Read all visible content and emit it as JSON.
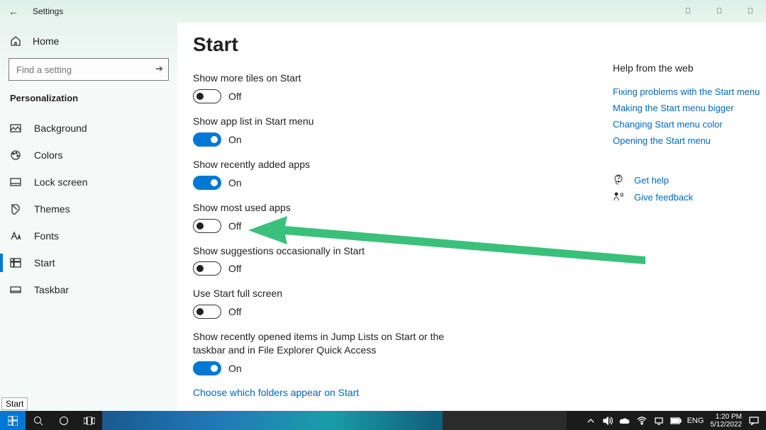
{
  "titlebar": {
    "title": "Settings"
  },
  "sidebar": {
    "home": "Home",
    "search_placeholder": "Find a setting",
    "category": "Personalization",
    "items": [
      {
        "id": "background",
        "label": "Background"
      },
      {
        "id": "colors",
        "label": "Colors"
      },
      {
        "id": "lockscreen",
        "label": "Lock screen"
      },
      {
        "id": "themes",
        "label": "Themes"
      },
      {
        "id": "fonts",
        "label": "Fonts"
      },
      {
        "id": "start",
        "label": "Start"
      },
      {
        "id": "taskbar",
        "label": "Taskbar"
      }
    ]
  },
  "page": {
    "title": "Start",
    "state_on": "On",
    "state_off": "Off",
    "settings": [
      {
        "id": "more-tiles",
        "label": "Show more tiles on Start",
        "on": false
      },
      {
        "id": "app-list",
        "label": "Show app list in Start menu",
        "on": true
      },
      {
        "id": "recent-apps",
        "label": "Show recently added apps",
        "on": true
      },
      {
        "id": "most-used",
        "label": "Show most used apps",
        "on": false
      },
      {
        "id": "suggestions",
        "label": "Show suggestions occasionally in Start",
        "on": false
      },
      {
        "id": "full-screen",
        "label": "Use Start full screen",
        "on": false
      },
      {
        "id": "recent-items",
        "label": "Show recently opened items in Jump Lists on Start or the taskbar and in File Explorer Quick Access",
        "on": true
      }
    ],
    "choose_folders_link": "Choose which folders appear on Start"
  },
  "help": {
    "title": "Help from the web",
    "links": [
      "Fixing problems with the Start menu",
      "Making the Start menu bigger",
      "Changing Start menu color",
      "Opening the Start menu"
    ],
    "get_help": "Get help",
    "feedback": "Give feedback"
  },
  "tooltip": "Start",
  "taskbar": {
    "lang": "ENG",
    "time": "1:20 PM",
    "date": "5/12/2022"
  }
}
